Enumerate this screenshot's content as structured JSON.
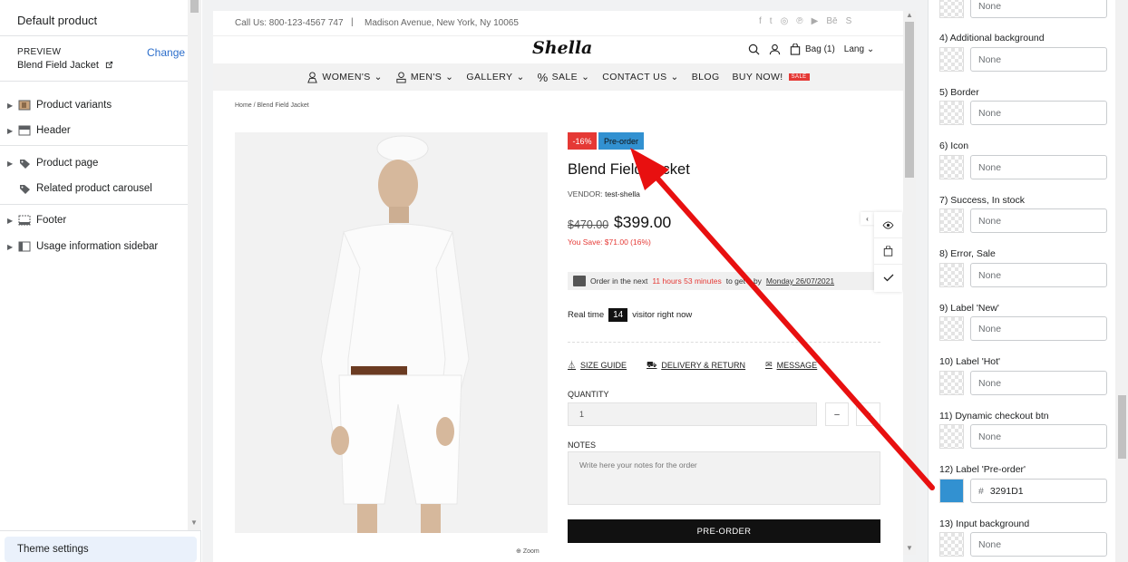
{
  "sidebar": {
    "title": "Default product",
    "preview_label": "PREVIEW",
    "preview_value": "Blend Field Jacket",
    "change_label": "Change",
    "items": [
      {
        "label": "Product variants",
        "icon": "image-icon"
      },
      {
        "label": "Header",
        "icon": "header-icon"
      },
      {
        "label": "Product page",
        "icon": "tag-icon"
      },
      {
        "label": "Related product carousel",
        "icon": "tag-icon"
      },
      {
        "label": "Footer",
        "icon": "footer-icon"
      },
      {
        "label": "Usage information sidebar",
        "icon": "sidebar-icon"
      }
    ],
    "theme_settings": "Theme settings"
  },
  "store": {
    "phone": "Call Us: 800-123-4567 747",
    "divider": "|",
    "address": "Madison Avenue, New York, Ny 10065",
    "logo": "Shella",
    "bag": "Bag (1)",
    "lang": "Lang",
    "nav": [
      "WOMEN'S",
      "MEN'S",
      "GALLERY",
      "SALE",
      "CONTACT US",
      "BLOG",
      "BUY NOW!"
    ],
    "nav_sale_badge": "SALE",
    "breadcrumb": "Home  /  Blend Field Jacket"
  },
  "product": {
    "badge_sale": "-16%",
    "badge_preorder": "Pre-order",
    "title": "Blend Field Jacket",
    "vendor_label": "VENDOR:",
    "vendor_value": "test-shella",
    "old_price": "$470.00",
    "new_price": "$399.00",
    "you_save": "You Save: $71.00 (16%)",
    "countdown_pre": "Order in the next",
    "countdown_time": "11 hours 53 minutes",
    "countdown_mid": "to get it by",
    "countdown_date": "Monday 26/07/2021",
    "realtime_pre": "Real time",
    "realtime_count": "14",
    "realtime_post": "visitor right now",
    "link_size": "SIZE GUIDE",
    "link_delivery": "DELIVERY & RETURN",
    "link_message": "MESSAGE",
    "quantity_label": "QUANTITY",
    "quantity_value": "1",
    "minus": "–",
    "plus": "+",
    "notes_label": "NOTES",
    "notes_placeholder": "Write here your notes for the order",
    "preorder_button": "PRE-ORDER",
    "zoom": "Zoom"
  },
  "colors_panel": {
    "items": [
      {
        "label": "",
        "value": "None"
      },
      {
        "label": "4) Additional background",
        "value": "None"
      },
      {
        "label": "5) Border",
        "value": "None"
      },
      {
        "label": "6) Icon",
        "value": "None"
      },
      {
        "label": "7) Success, In stock",
        "value": "None"
      },
      {
        "label": "8) Error, Sale",
        "value": "None"
      },
      {
        "label": "9) Label 'New'",
        "value": "None"
      },
      {
        "label": "10) Label 'Hot'",
        "value": "None"
      },
      {
        "label": "11) Dynamic checkout btn",
        "value": "None"
      },
      {
        "label": "12) Label 'Pre-order'",
        "value": "3291D1"
      },
      {
        "label": "13) Input background",
        "value": "None"
      }
    ],
    "hash": "#",
    "preorder_color": "#3291D1"
  },
  "colors": {
    "accent_red": "#e53935",
    "preorder_blue": "#3291D1",
    "link_blue": "#2c6ecb"
  }
}
